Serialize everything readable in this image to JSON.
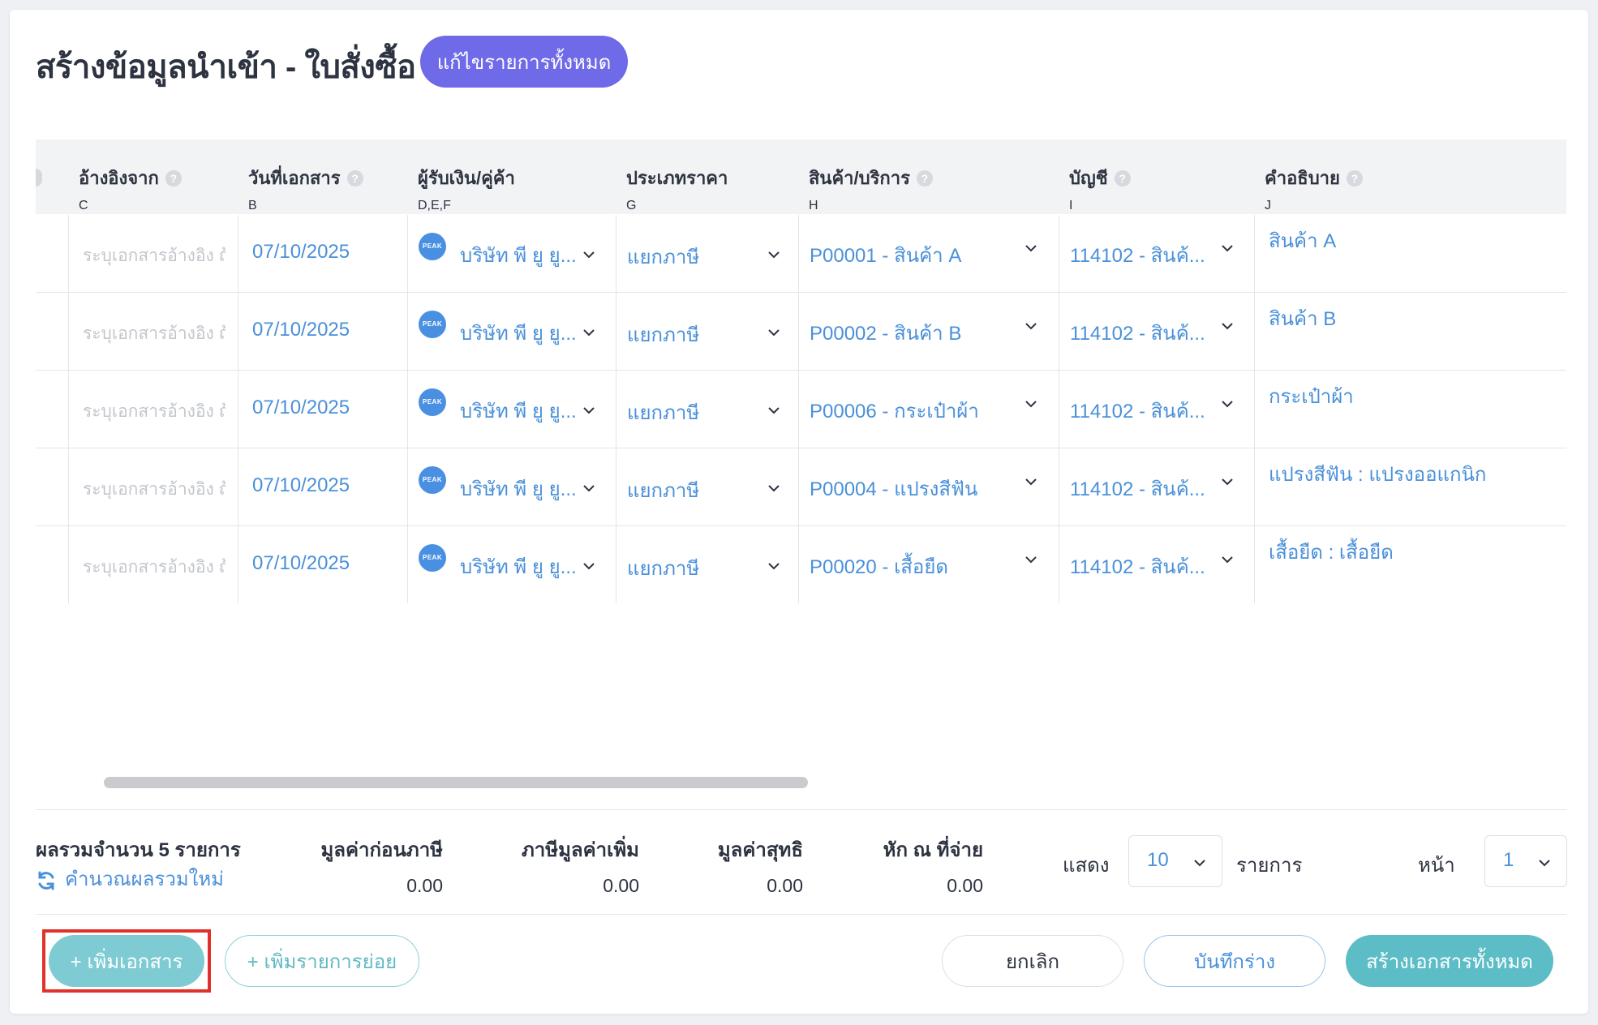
{
  "page": {
    "title": "สร้างข้อมูลนำเข้า - ใบสั่งซื้อ",
    "edit_all_button": "แก้ไขรายการทั้งหมด"
  },
  "table": {
    "columns": [
      {
        "label": "อ้างอิงจาก",
        "col": "C"
      },
      {
        "label": "วันที่เอกสาร",
        "col": "B"
      },
      {
        "label": "ผู้รับเงิน/คู่ค้า",
        "col": "D,E,F"
      },
      {
        "label": "ประเภทราคา",
        "col": "G"
      },
      {
        "label": "สินค้า/บริการ",
        "col": "H"
      },
      {
        "label": "บัญชี",
        "col": "I"
      },
      {
        "label": "คำอธิบาย",
        "col": "J"
      }
    ],
    "help_glyph": "?",
    "logo_text": "PEAK",
    "rows": [
      {
        "ref": "ระบุเอกสารอ้างอิง ถ้",
        "date": "07/10/2025",
        "vendor": "บริษัท พี ยู ยู...",
        "price_type": "แยกภาษี",
        "product": "P00001 - สินค้า A",
        "account": "114102 - สินค้...",
        "description": "สินค้า A"
      },
      {
        "ref": "ระบุเอกสารอ้างอิง ถ้",
        "date": "07/10/2025",
        "vendor": "บริษัท พี ยู ยู...",
        "price_type": "แยกภาษี",
        "product": "P00002 - สินค้า B",
        "account": "114102 - สินค้...",
        "description": "สินค้า B"
      },
      {
        "ref": "ระบุเอกสารอ้างอิง ถ้",
        "date": "07/10/2025",
        "vendor": "บริษัท พี ยู ยู...",
        "price_type": "แยกภาษี",
        "product": "P00006 - กระเป๋าผ้า",
        "account": "114102 - สินค้...",
        "description": "กระเป๋าผ้า"
      },
      {
        "ref": "ระบุเอกสารอ้างอิง ถ้",
        "date": "07/10/2025",
        "vendor": "บริษัท พี ยู ยู...",
        "price_type": "แยกภาษี",
        "product": "P00004 - แปรงสีฟัน",
        "account": "114102 - สินค้...",
        "description": "แปรงสีฟัน : แปรงออแกนิก"
      },
      {
        "ref": "ระบุเอกสารอ้างอิง ถ้",
        "date": "07/10/2025",
        "vendor": "บริษัท พี ยู ยู...",
        "price_type": "แยกภาษี",
        "product": "P00020 - เสื้อยืด",
        "account": "114102 - สินค้...",
        "description": "เสื้อยืด : เสื้อยืด"
      }
    ]
  },
  "summary": {
    "title": "ผลรวมจำนวน 5 รายการ",
    "recalc_label": "คำนวณผลรวมใหม่",
    "pre_tax_label": "มูลค่าก่อนภาษี",
    "pre_tax_value": "0.00",
    "vat_label": "ภาษีมูลค่าเพิ่ม",
    "vat_value": "0.00",
    "net_label": "มูลค่าสุทธิ",
    "net_value": "0.00",
    "wht_label": "หัก ณ ที่จ่าย",
    "wht_value": "0.00"
  },
  "pagination": {
    "show_label": "แสดง",
    "per_page": "10",
    "items_label": "รายการ",
    "page_label": "หน้า",
    "page": "1"
  },
  "actions": {
    "add_document": "+ เพิ่มเอกสาร",
    "add_sub_item": "+ เพิ่มรายการย่อย",
    "cancel": "ยกเลิก",
    "save_draft": "บันทึกร่าง",
    "create_all": "สร้างเอกสารทั้งหมด"
  },
  "colors": {
    "accent_purple": "#6f6ae8",
    "link_blue": "#4a90d9",
    "teal": "#7ecbd3",
    "highlight_red": "#e0322a"
  }
}
